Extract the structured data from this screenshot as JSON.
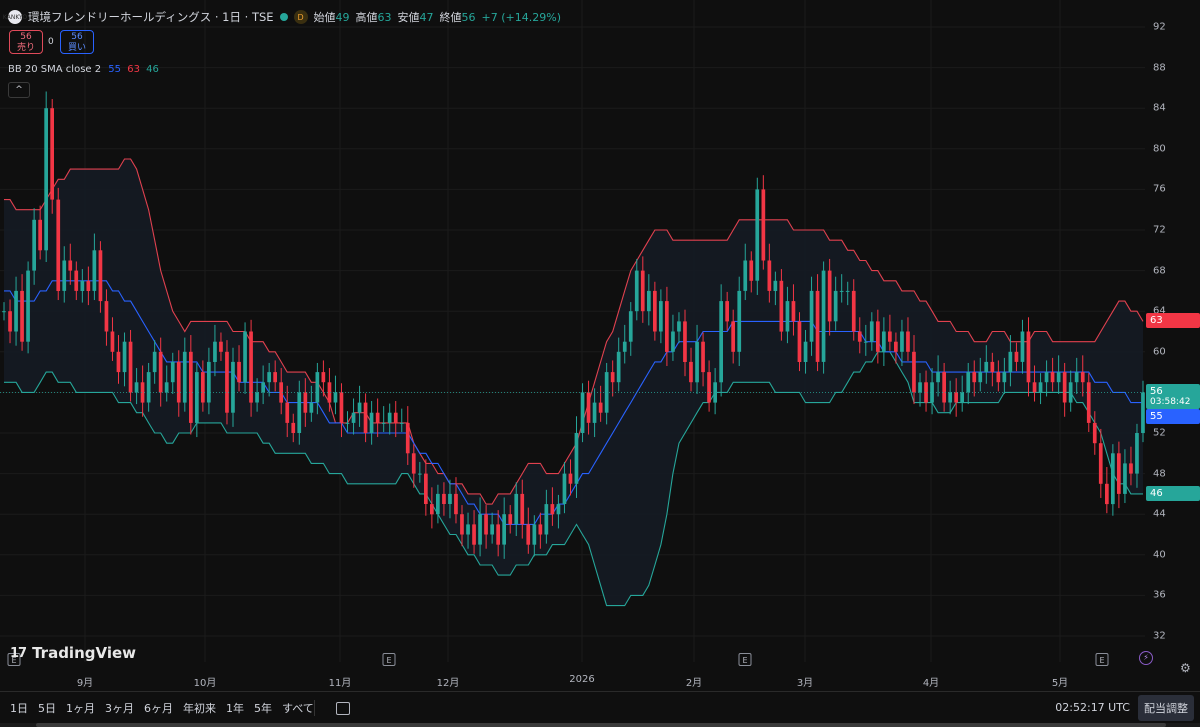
{
  "header": {
    "logo_text": "KANKYO",
    "symbol": "環境フレンドリーホールディングス · 1日 · TSE",
    "interval_badge": "D",
    "open_label": "始値",
    "open": "49",
    "high_label": "高値",
    "high": "63",
    "low_label": "安値",
    "low": "47",
    "close_label": "終値",
    "close": "56",
    "change": "+7 (+14.29%)"
  },
  "trade": {
    "sell_price": "56",
    "sell_label": "売り",
    "spread": "0",
    "buy_price": "56",
    "buy_label": "買い"
  },
  "indicator": {
    "name": "BB 20 SMA close 2",
    "basis": "55",
    "upper": "63",
    "lower": "46",
    "collapse_icon": "^"
  },
  "price_axis": {
    "ticks": [
      "92",
      "88",
      "84",
      "80",
      "76",
      "72",
      "68",
      "64",
      "60",
      "56",
      "52",
      "48",
      "44",
      "40",
      "36",
      "32"
    ],
    "last_price": "56",
    "countdown": "03:58:42",
    "upper_label": "63",
    "basis_label": "55",
    "lower_label": "46"
  },
  "time_axis": {
    "labels": [
      {
        "text": "9月",
        "pos": 85
      },
      {
        "text": "10月",
        "pos": 205
      },
      {
        "text": "11月",
        "pos": 340
      },
      {
        "text": "12月",
        "pos": 448
      },
      {
        "text": "2026",
        "pos": 582
      },
      {
        "text": "2月",
        "pos": 694
      },
      {
        "text": "3月",
        "pos": 805
      },
      {
        "text": "4月",
        "pos": 931
      },
      {
        "text": "5月",
        "pos": 1060
      }
    ],
    "event_marker": "E"
  },
  "brand": {
    "name": "TradingView",
    "mark": "17"
  },
  "bottombar": {
    "ranges": [
      "1日",
      "5日",
      "1ヶ月",
      "3ヶ月",
      "6ヶ月",
      "年初来",
      "1年",
      "5年",
      "すべて"
    ],
    "clock": "02:52:17 UTC",
    "adjust": "配当調整"
  },
  "colors": {
    "background": "#0f0f0f",
    "up": "#26a69a",
    "down": "#f23645",
    "upper_band": "#e0414f",
    "lower_band": "#26a69a",
    "basis": "#2962ff",
    "band_fill": "#151b24"
  },
  "chart_data": {
    "type": "candlestick",
    "indicator": "Bollinger Bands (20, 2)",
    "ylim": [
      30,
      94
    ],
    "x_labels": [
      "9月",
      "10月",
      "11月",
      "12月",
      "2026",
      "2月",
      "3月",
      "4月",
      "5月"
    ],
    "close": [
      64,
      62,
      66,
      61,
      68,
      73,
      70,
      84,
      75,
      66,
      69,
      68,
      66,
      67,
      66,
      70,
      65,
      62,
      60,
      58,
      61,
      56,
      57,
      55,
      58,
      60,
      56,
      57,
      59,
      55,
      60,
      53,
      58,
      55,
      59,
      61,
      60,
      54,
      59,
      57,
      62,
      55,
      56,
      57,
      58,
      57,
      55,
      53,
      52,
      56,
      54,
      55,
      58,
      57,
      55,
      56,
      53,
      53,
      54,
      55,
      52,
      54,
      53,
      53,
      54,
      53,
      53,
      50,
      48,
      48,
      45,
      44,
      46,
      45,
      46,
      44,
      42,
      43,
      41,
      44,
      42,
      43,
      41,
      44,
      43,
      46,
      43,
      41,
      43,
      42,
      45,
      44,
      45,
      48,
      47,
      52,
      56,
      53,
      55,
      54,
      58,
      57,
      60,
      61,
      64,
      68,
      64,
      66,
      62,
      65,
      60,
      62,
      63,
      59,
      57,
      61,
      58,
      55,
      57,
      65,
      63,
      60,
      66,
      69,
      67,
      76,
      69,
      66,
      67,
      62,
      65,
      63,
      59,
      61,
      66,
      59,
      68,
      63,
      66,
      66,
      66,
      62,
      61,
      61,
      63,
      60,
      62,
      61,
      60,
      62,
      60,
      56,
      57,
      55,
      57,
      58,
      55,
      56,
      55,
      56,
      58,
      57,
      58,
      59,
      58,
      57,
      58,
      60,
      59,
      62,
      57,
      56,
      57,
      58,
      57,
      58,
      55,
      57,
      58,
      57,
      53,
      51,
      47,
      45,
      50,
      46,
      49,
      48,
      52,
      56
    ],
    "bb_upper": [
      75,
      75,
      74,
      74,
      74,
      74,
      74,
      75,
      76,
      77,
      77,
      78,
      78,
      78,
      78,
      78,
      78,
      78,
      78,
      78,
      79,
      79,
      78,
      76,
      74,
      71,
      68,
      66,
      64,
      63,
      62,
      63,
      63,
      63,
      63,
      63,
      63,
      63,
      62,
      62,
      62,
      61,
      61,
      61,
      60,
      60,
      59,
      58,
      58,
      58,
      58,
      57,
      57,
      56,
      55,
      53,
      53,
      53,
      54,
      54,
      54,
      53,
      53,
      53,
      53,
      53,
      53,
      53,
      51,
      50,
      49,
      49,
      48,
      48,
      47,
      47,
      47,
      46,
      46,
      46,
      45,
      45,
      46,
      46,
      46,
      47,
      48,
      49,
      49,
      49,
      48,
      48,
      48,
      49,
      50,
      51,
      53,
      55,
      57,
      59,
      61,
      62,
      64,
      66,
      68,
      69,
      70,
      71,
      72,
      72,
      72,
      71,
      71,
      71,
      71,
      71,
      71,
      71,
      71,
      71,
      71,
      72,
      73,
      73,
      73,
      73,
      73,
      73,
      73,
      73,
      73,
      72,
      72,
      72,
      72,
      72,
      72,
      71,
      71,
      71,
      70,
      70,
      69,
      69,
      68,
      68,
      67,
      67,
      67,
      66,
      66,
      66,
      65,
      65,
      64,
      63,
      63,
      63,
      62,
      62,
      62,
      61,
      61,
      61,
      62,
      62,
      62,
      61,
      61,
      61,
      61,
      62,
      62,
      62,
      61,
      61,
      61,
      61,
      61,
      61,
      61,
      61,
      62,
      63,
      64,
      65,
      65,
      64,
      64,
      63
    ],
    "bb_lower": [
      57,
      57,
      57,
      56,
      56,
      56,
      57,
      58,
      58,
      57,
      57,
      57,
      56,
      56,
      56,
      56,
      56,
      56,
      56,
      55,
      55,
      55,
      54,
      54,
      53,
      52,
      52,
      51,
      51,
      52,
      52,
      52,
      53,
      53,
      53,
      53,
      53,
      52,
      52,
      52,
      52,
      52,
      52,
      51,
      51,
      50,
      50,
      50,
      50,
      50,
      50,
      49,
      49,
      49,
      48,
      48,
      48,
      47,
      47,
      47,
      47,
      47,
      47,
      47,
      47,
      47,
      48,
      48,
      47,
      46,
      46,
      45,
      44,
      43,
      42,
      42,
      41,
      40,
      40,
      39,
      39,
      39,
      38,
      38,
      38,
      39,
      39,
      39,
      40,
      40,
      40,
      41,
      41,
      41,
      42,
      43,
      42,
      41,
      39,
      37,
      35,
      35,
      35,
      35,
      36,
      36,
      36,
      37,
      39,
      41,
      44,
      48,
      51,
      52,
      53,
      54,
      55,
      55,
      56,
      56,
      56,
      57,
      57,
      57,
      57,
      57,
      57,
      57,
      56,
      56,
      56,
      56,
      56,
      55,
      55,
      55,
      55,
      55,
      56,
      56,
      57,
      58,
      58,
      59,
      59,
      60,
      60,
      60,
      59,
      58,
      57,
      55,
      55,
      55,
      55,
      54,
      54,
      54,
      55,
      55,
      55,
      55,
      55,
      55,
      55,
      55,
      56,
      56,
      56,
      56,
      56,
      56,
      56,
      56,
      56,
      56,
      56,
      56,
      55,
      55,
      54,
      53,
      52,
      50,
      48,
      47,
      47,
      46,
      46,
      46
    ],
    "bb_basis": [
      66,
      66,
      65,
      65,
      65,
      65,
      66,
      66,
      67,
      67,
      67,
      67,
      67,
      67,
      67,
      67,
      67,
      67,
      66,
      66,
      65,
      65,
      64,
      63,
      62,
      61,
      60,
      59,
      59,
      59,
      59,
      59,
      59,
      58,
      58,
      58,
      58,
      58,
      58,
      57,
      57,
      57,
      57,
      57,
      56,
      56,
      56,
      55,
      55,
      55,
      55,
      55,
      55,
      54,
      53,
      53,
      53,
      52,
      52,
      52,
      52,
      52,
      52,
      52,
      52,
      52,
      52,
      52,
      51,
      50,
      50,
      49,
      49,
      48,
      47,
      47,
      46,
      45,
      45,
      44,
      44,
      44,
      44,
      43,
      43,
      43,
      43,
      43,
      43,
      44,
      44,
      44,
      45,
      45,
      46,
      47,
      48,
      48,
      49,
      50,
      51,
      52,
      53,
      54,
      55,
      56,
      57,
      58,
      59,
      59,
      60,
      60,
      61,
      61,
      61,
      61,
      62,
      62,
      62,
      62,
      62,
      63,
      63,
      63,
      63,
      63,
      63,
      63,
      63,
      63,
      63,
      63,
      63,
      63,
      63,
      62,
      62,
      62,
      62,
      62,
      62,
      62,
      62,
      61,
      61,
      61,
      60,
      60,
      60,
      59,
      59,
      59,
      59,
      59,
      58,
      58,
      58,
      58,
      58,
      58,
      58,
      58,
      58,
      58,
      58,
      58,
      58,
      58,
      58,
      58,
      58,
      58,
      58,
      58,
      58,
      58,
      58,
      58,
      58,
      58,
      58,
      57,
      57,
      57,
      56,
      56,
      56,
      55,
      55,
      55
    ]
  }
}
